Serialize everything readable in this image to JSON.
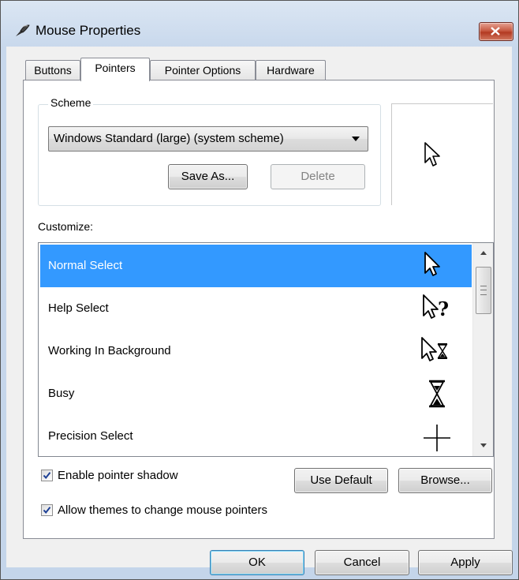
{
  "window": {
    "title": "Mouse Properties",
    "icon": "mouse-icon",
    "close_icon": "close-icon"
  },
  "tabs": [
    {
      "label": "Buttons",
      "active": false
    },
    {
      "label": "Pointers",
      "active": true
    },
    {
      "label": "Pointer Options",
      "active": false
    },
    {
      "label": "Hardware",
      "active": false
    }
  ],
  "scheme": {
    "group_label": "Scheme",
    "selected": "Windows Standard (large) (system scheme)",
    "save_as_label": "Save As...",
    "delete_label": "Delete"
  },
  "preview": {
    "cursor_icon": "arrow-cursor-icon"
  },
  "customize": {
    "label": "Customize:",
    "items": [
      {
        "label": "Normal Select",
        "cursor_icon": "arrow-cursor-icon",
        "selected": true
      },
      {
        "label": "Help Select",
        "cursor_icon": "help-cursor-icon",
        "selected": false
      },
      {
        "label": "Working In Background",
        "cursor_icon": "working-cursor-icon",
        "selected": false
      },
      {
        "label": "Busy",
        "cursor_icon": "hourglass-cursor-icon",
        "selected": false
      },
      {
        "label": "Precision Select",
        "cursor_icon": "crosshair-cursor-icon",
        "selected": false
      }
    ]
  },
  "options": {
    "enable_shadow_label": "Enable pointer shadow",
    "enable_shadow_checked": true,
    "allow_themes_label": "Allow themes to change mouse pointers",
    "allow_themes_checked": true,
    "use_default_label": "Use Default",
    "browse_label": "Browse..."
  },
  "footer": {
    "ok_label": "OK",
    "cancel_label": "Cancel",
    "apply_label": "Apply"
  },
  "colors": {
    "selection": "#3399ff",
    "frame": "#c8d8ec",
    "close_button": "#c85a43"
  }
}
